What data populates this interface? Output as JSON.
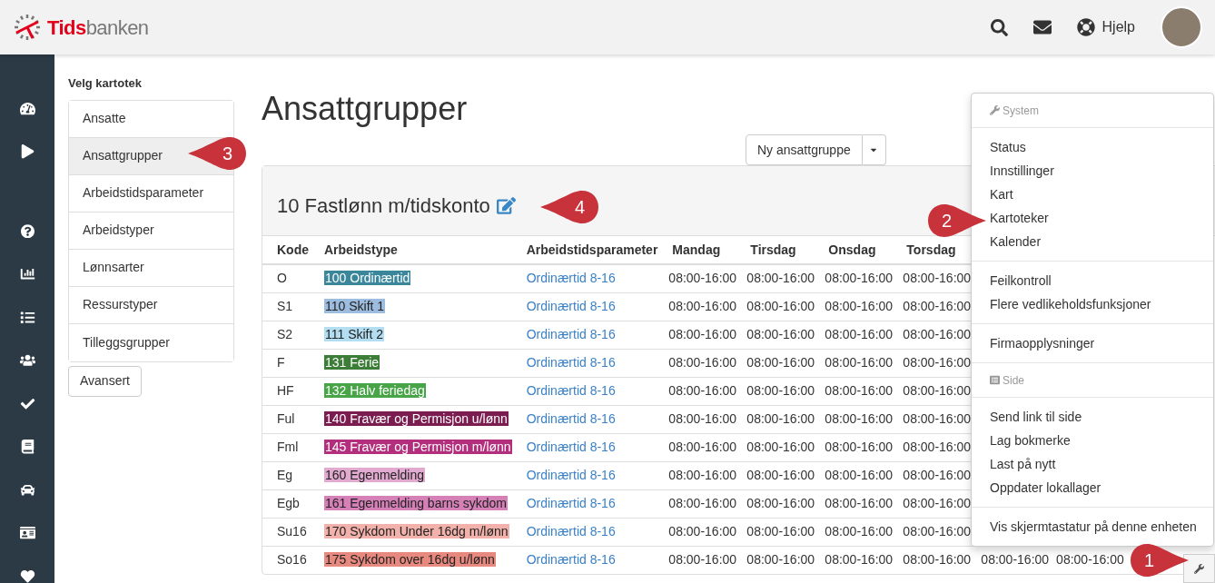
{
  "header": {
    "logo": {
      "brand_red": "Tids",
      "brand_gray": "banken"
    },
    "help": "Hjelp"
  },
  "catalog_panel": {
    "title": "Velg kartotek",
    "items": [
      {
        "label": "Ansatte",
        "selected": false
      },
      {
        "label": "Ansattgrupper",
        "selected": true
      },
      {
        "label": "Arbeidstidsparameter",
        "selected": false
      },
      {
        "label": "Arbeidstyper",
        "selected": false
      },
      {
        "label": "Lønnsarter",
        "selected": false
      },
      {
        "label": "Ressurstyper",
        "selected": false
      },
      {
        "label": "Tilleggsgrupper",
        "selected": false
      }
    ],
    "button": "Avansert"
  },
  "page": {
    "title": "Ansattgrupper",
    "new_button": "Ny ansattgruppe"
  },
  "group": {
    "title": "10 Fastlønn m/tidskonto",
    "columns": [
      "Kode",
      "Arbeidstype",
      "Arbeidstidsparameter",
      "Mandag",
      "Tirsdag",
      "Onsdag",
      "Torsdag"
    ],
    "rows": [
      {
        "code": "O",
        "type": "100 Ordinærtid",
        "color": "#3a879c",
        "param": "Ordinærtid 8-16",
        "times": [
          "08:00-16:00",
          "08:00-16:00",
          "08:00-16:00",
          "08:00-16:00"
        ]
      },
      {
        "code": "S1",
        "type": "110 Skift 1",
        "color": "#9dbde0",
        "param": "Ordinærtid 8-16",
        "times": [
          "08:00-16:00",
          "08:00-16:00",
          "08:00-16:00",
          "08:00-16:00"
        ]
      },
      {
        "code": "S2",
        "type": "111 Skift 2",
        "color": "#b3def2",
        "param": "Ordinærtid 8-16",
        "times": [
          "08:00-16:00",
          "08:00-16:00",
          "08:00-16:00",
          "08:00-16:00"
        ]
      },
      {
        "code": "F",
        "type": "131 Ferie",
        "color": "#3c7d38",
        "param": "Ordinærtid 8-16",
        "times": [
          "08:00-16:00",
          "08:00-16:00",
          "08:00-16:00",
          "08:00-16:00"
        ]
      },
      {
        "code": "HF",
        "type": "132 Halv feriedag",
        "color": "#47a447",
        "param": "Ordinærtid 8-16",
        "times": [
          "08:00-16:00",
          "08:00-16:00",
          "08:00-16:00",
          "08:00-16:00"
        ]
      },
      {
        "code": "Ful",
        "type": "140 Fravær og Permisjon u/lønn",
        "color": "#7b1d50",
        "param": "Ordinærtid 8-16",
        "times": [
          "08:00-16:00",
          "08:00-16:00",
          "08:00-16:00",
          "08:00-16:00"
        ]
      },
      {
        "code": "Fml",
        "type": "145 Fravær og Permisjon m/lønn",
        "color": "#b32e7c",
        "param": "Ordinærtid 8-16",
        "times": [
          "08:00-16:00",
          "08:00-16:00",
          "08:00-16:00",
          "08:00-16:00"
        ]
      },
      {
        "code": "Eg",
        "type": "160 Egenmelding",
        "color": "#e2aad0",
        "param": "Ordinærtid 8-16",
        "times": [
          "08:00-16:00",
          "08:00-16:00",
          "08:00-16:00",
          "08:00-16:00"
        ]
      },
      {
        "code": "Egb",
        "type": "161 Egenmelding barns sykdom",
        "color": "#d680b8",
        "param": "Ordinærtid 8-16",
        "times": [
          "08:00-16:00",
          "08:00-16:00",
          "08:00-16:00",
          "08:00-16:00"
        ]
      },
      {
        "code": "Su16",
        "type": "170 Sykdom Under 16dg m/lønn",
        "color": "#f2b1aa",
        "param": "Ordinærtid 8-16",
        "times": [
          "08:00-16:00",
          "08:00-16:00",
          "08:00-16:00",
          "08:00-16:00"
        ]
      },
      {
        "code": "So16",
        "type": "175 Sykdom over 16dg u/lønn",
        "color": "#e8897f",
        "param": "Ordinærtid 8-16",
        "times": [
          "08:00-16:00",
          "08:00-16:00",
          "08:00-16:00",
          "08:00-16:00",
          "08:00-16:00",
          "08:00-16:00"
        ]
      }
    ]
  },
  "menu": {
    "sections": [
      {
        "header": "System",
        "groups": [
          [
            "Status",
            "Innstillinger",
            "Kart",
            "Kartoteker",
            "Kalender"
          ],
          [
            "Feilkontroll",
            "Flere vedlikeholdsfunksjoner"
          ],
          [
            "Firmaopplysninger"
          ]
        ]
      },
      {
        "header": "Side",
        "groups": [
          [
            "Send link til side",
            "Lag bokmerke",
            "Last på nytt",
            "Oppdater lokallager"
          ],
          [
            "Vis skjermtastatur på denne enheten"
          ]
        ]
      }
    ]
  },
  "callouts": [
    {
      "number": "1"
    },
    {
      "number": "2"
    },
    {
      "number": "3"
    },
    {
      "number": "4"
    }
  ]
}
